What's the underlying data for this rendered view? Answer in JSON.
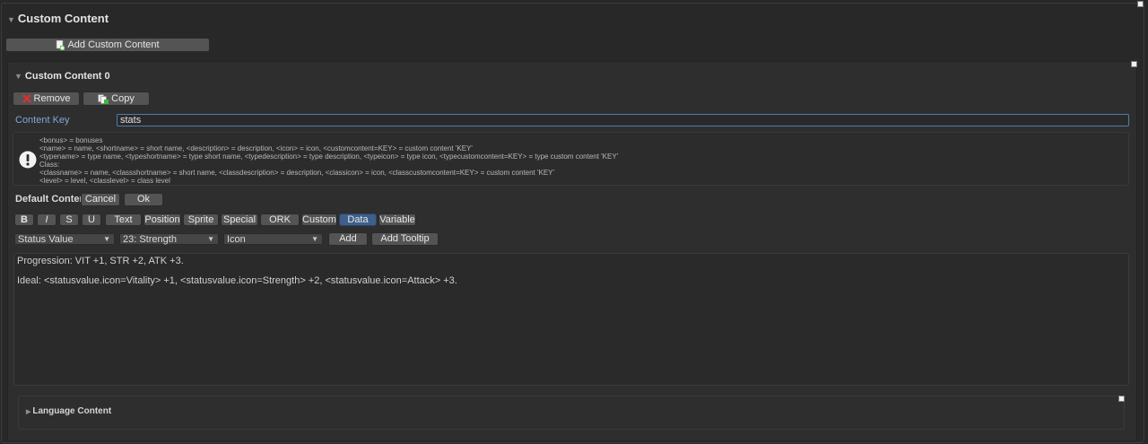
{
  "header": {
    "title": "Custom Content"
  },
  "add_button": {
    "label": "Add Custom Content"
  },
  "item": {
    "title": "Custom Content 0",
    "remove_label": "Remove",
    "copy_label": "Copy",
    "content_key_label": "Content Key",
    "content_key_value": "stats",
    "help_lines": [
      "<bonus> = bonuses",
      "<name> = name, <shortname> = short name, <description> = description, <icon> = icon, <customcontent=KEY> = custom content 'KEY'",
      "<typename> = type name, <typeshortname> = type short name, <typedescription> = type description, <typeicon> = type icon, <typecustomcontent=KEY> = type custom content 'KEY'",
      "Class:",
      "<classname> = name, <classshortname> = short name, <classdescription> = description, <classicon> = icon, <classcustomcontent=KEY> = custom content 'KEY'",
      "<level> = level, <classlevel> = class level"
    ],
    "default_content_label": "Default Content",
    "cancel_label": "Cancel",
    "ok_label": "Ok",
    "format_buttons": [
      "B",
      "I",
      "S",
      "U"
    ],
    "tabs": [
      "Text",
      "Position",
      "Sprite",
      "Special",
      "ORK",
      "Custom",
      "Data",
      "Variable"
    ],
    "active_tab": "Data",
    "dropdowns": {
      "type": "Status Value",
      "value": "23: Strength",
      "mode": "Icon"
    },
    "add_label": "Add",
    "add_tooltip_label": "Add Tooltip",
    "editor_lines": [
      "Progression: VIT +1, STR +2, ATK +3.",
      "Ideal: <statusvalue.icon=Vitality> +1, <statusvalue.icon=Strength> +2, <statusvalue.icon=Attack> +3."
    ],
    "language_content_label": "Language Content"
  },
  "colors": {
    "background": "#282828",
    "accent": "#3e5f8a",
    "label_blue": "#7ea7d8"
  },
  "icons": [
    "add-content-icon",
    "remove-x-icon",
    "copy-icon",
    "info-icon",
    "expand-triangle-icon"
  ]
}
